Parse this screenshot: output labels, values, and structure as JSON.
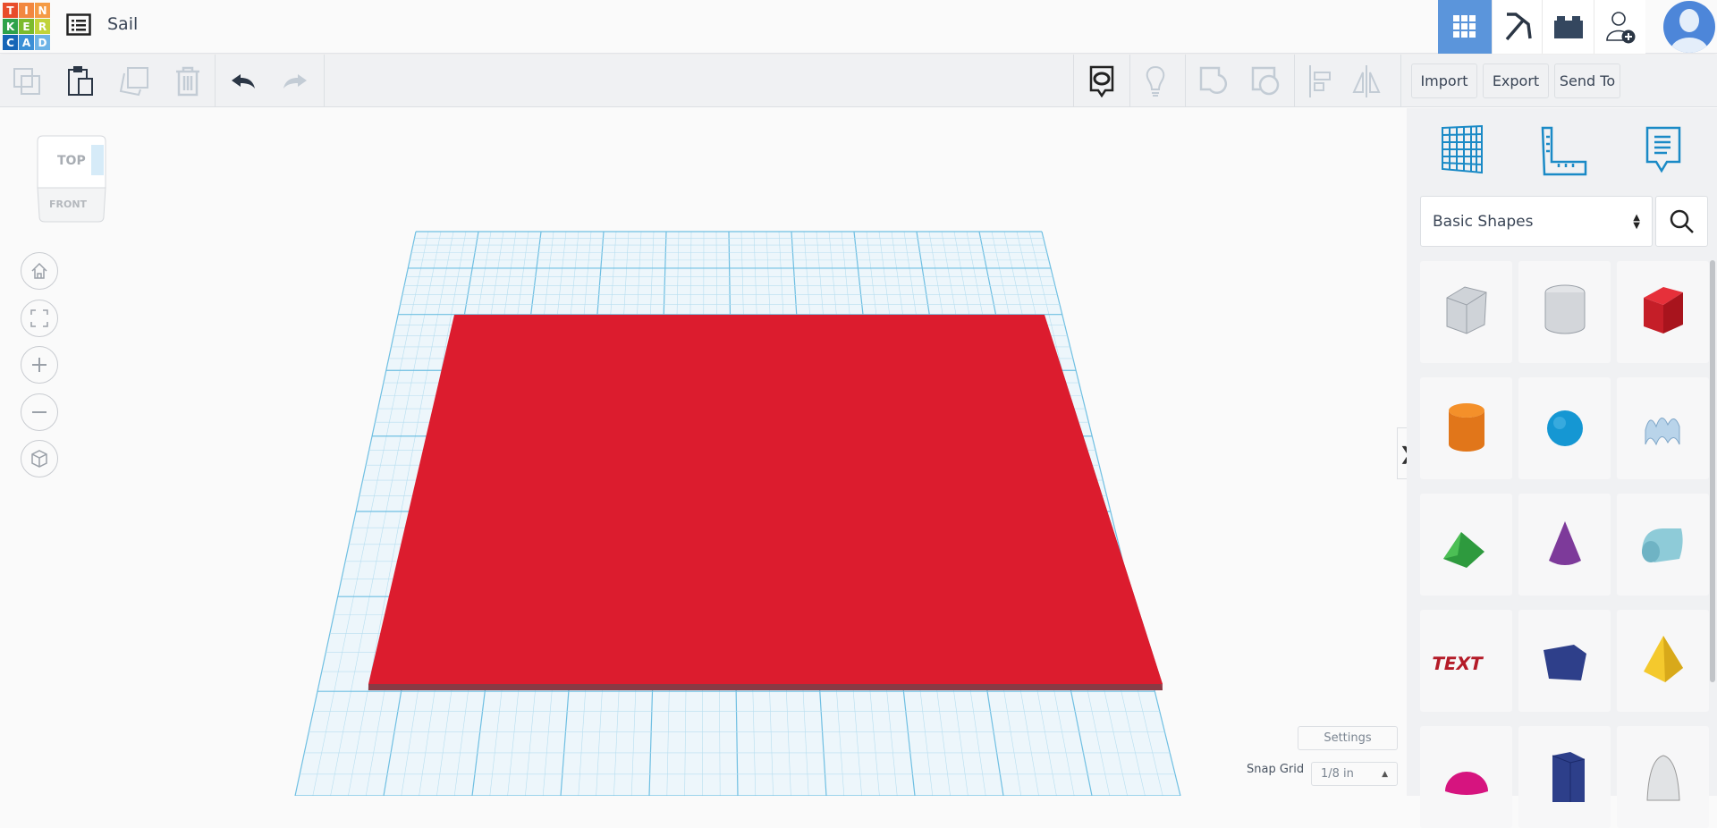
{
  "app": {
    "logo_letters": [
      "T",
      "I",
      "N",
      "K",
      "E",
      "R",
      "C",
      "A",
      "D"
    ],
    "project_title": "Sail"
  },
  "header": {
    "icons": [
      "3d-design-grid-icon",
      "pickaxe-icon",
      "brick-icon",
      "add-user-icon",
      "avatar"
    ]
  },
  "toolbar": {
    "import_label": "Import",
    "export_label": "Export",
    "send_to_label": "Send To"
  },
  "viewcube": {
    "top": "TOP",
    "front": "FRONT"
  },
  "panel": {
    "category": "Basic Shapes",
    "shapes": [
      "Box (hole)",
      "Cylinder (hole)",
      "Box",
      "Cylinder",
      "Sphere",
      "Scribble",
      "Roof",
      "Cone",
      "Round Roof",
      "Text",
      "Wedge",
      "Pyramid",
      "Half Sphere",
      "Polygon",
      "Paraboloid"
    ],
    "text_shape_label": "TEXT"
  },
  "workplane": {
    "settings_label": "Settings",
    "snap_grid_label": "Snap Grid",
    "snap_grid_value": "1/8 in",
    "plate_color": "#dc1c2e"
  }
}
